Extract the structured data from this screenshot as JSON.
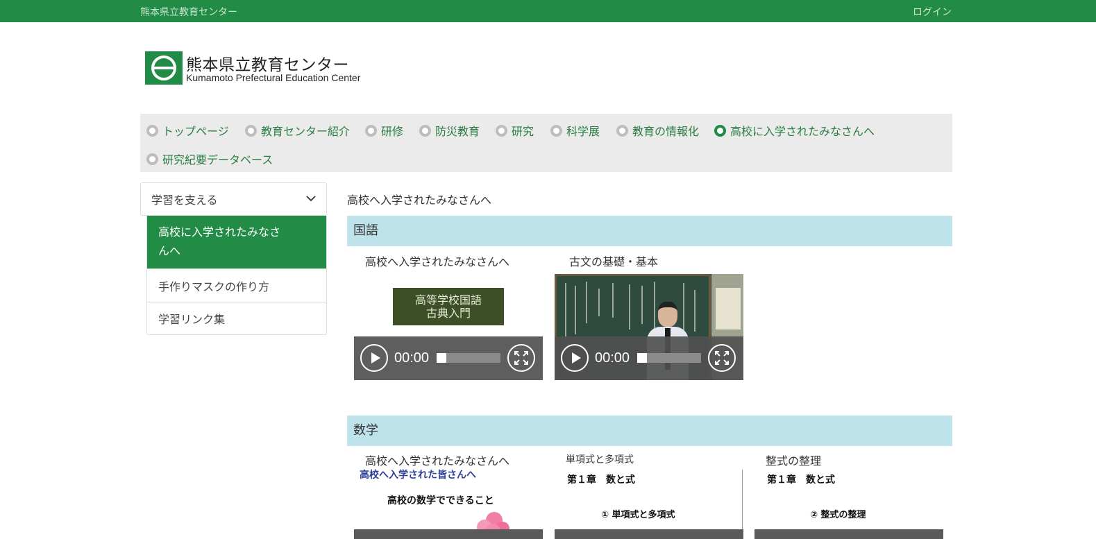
{
  "topbar": {
    "site_name": "熊本県立教育センター",
    "login": "ログイン"
  },
  "logo": {
    "jp": "熊本県立教育センター",
    "en": "Kumamoto Prefectural Education Center"
  },
  "gnav": {
    "items": [
      {
        "label": "トップページ",
        "active": false
      },
      {
        "label": "教育センター紹介",
        "active": false
      },
      {
        "label": "研修",
        "active": false
      },
      {
        "label": "防災教育",
        "active": false
      },
      {
        "label": "研究",
        "active": false
      },
      {
        "label": "科学展",
        "active": false
      },
      {
        "label": "教育の情報化",
        "active": false
      },
      {
        "label": "高校に入学されたみなさんへ",
        "active": true
      },
      {
        "label": "研究紀要データベース",
        "active": false
      }
    ]
  },
  "sidebar": {
    "heading": "学習を支える",
    "items": [
      {
        "label": "高校に入学されたみなさんへ",
        "active": true
      },
      {
        "label": "手作りマスクの作り方",
        "active": false
      },
      {
        "label": "学習リンク集",
        "active": false
      }
    ]
  },
  "main": {
    "title": "高校へ入学されたみなさんへ",
    "sections": [
      {
        "heading": "国語",
        "videos": [
          {
            "label": "高校へ入学されたみなさんへ",
            "thumb_text_1": "高等学校国語",
            "thumb_text_2": "古典入門",
            "time": "00:00"
          },
          {
            "label": "古文の基礎・基本",
            "time": "00:00"
          }
        ]
      },
      {
        "heading": "数学",
        "videos": [
          {
            "label": "高校へ入学されたみなさんへ",
            "thumb_line_1": "高校へ入学された皆さんへ",
            "thumb_line_2": "高校の数学でできること"
          },
          {
            "label": "単項式と多項式",
            "thumb_line_1": "第１章　数と式",
            "thumb_line_2": "①  単項式と多項式"
          },
          {
            "label": "整式の整理",
            "thumb_line_1": "第１章　数と式",
            "thumb_line_2": "②  整式の整理"
          }
        ]
      }
    ]
  },
  "colors": {
    "brand_green": "#228b45",
    "section_bg": "#bfe3ea",
    "nav_bg": "#ebebeb"
  },
  "icons": {
    "play": "play-icon",
    "fullscreen": "fullscreen-icon",
    "chevron": "chevron-down-icon"
  }
}
